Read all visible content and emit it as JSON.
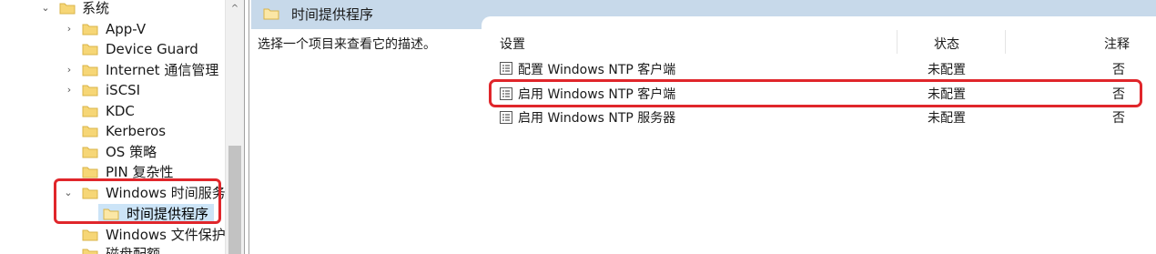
{
  "tree": {
    "items": [
      {
        "label": "系统",
        "chevron": "⌄"
      },
      {
        "label": "App-V",
        "chevron": "›"
      },
      {
        "label": "Device Guard",
        "chevron": ""
      },
      {
        "label": "Internet 通信管理",
        "chevron": "›"
      },
      {
        "label": "iSCSI",
        "chevron": "›"
      },
      {
        "label": "KDC",
        "chevron": ""
      },
      {
        "label": "Kerberos",
        "chevron": ""
      },
      {
        "label": "OS 策略",
        "chevron": ""
      },
      {
        "label": "PIN 复杂性",
        "chevron": ""
      },
      {
        "label": "Windows 时间服务",
        "chevron": "⌄"
      },
      {
        "label": "时间提供程序",
        "chevron": ""
      },
      {
        "label": "Windows 文件保护",
        "chevron": ""
      },
      {
        "label": "磁盘配额",
        "chevron": ""
      }
    ]
  },
  "scrollbar": {
    "up_arrow": "^"
  },
  "main": {
    "header_title": "时间提供程序",
    "description": "选择一个项目来查看它的描述。",
    "columns": {
      "setting": "设置",
      "status": "状态",
      "comment": "注释"
    },
    "rows": [
      {
        "name": "配置 Windows NTP 客户端",
        "status": "未配置",
        "comment": "否"
      },
      {
        "name": "启用 Windows NTP 客户端",
        "status": "未配置",
        "comment": "否"
      },
      {
        "name": "启用 Windows NTP 服务器",
        "status": "未配置",
        "comment": "否"
      }
    ]
  },
  "colors": {
    "header_band": "#c7d9ea",
    "selection": "#cce4f7",
    "highlight_border": "#e0262b",
    "folder": "#f6d676"
  }
}
